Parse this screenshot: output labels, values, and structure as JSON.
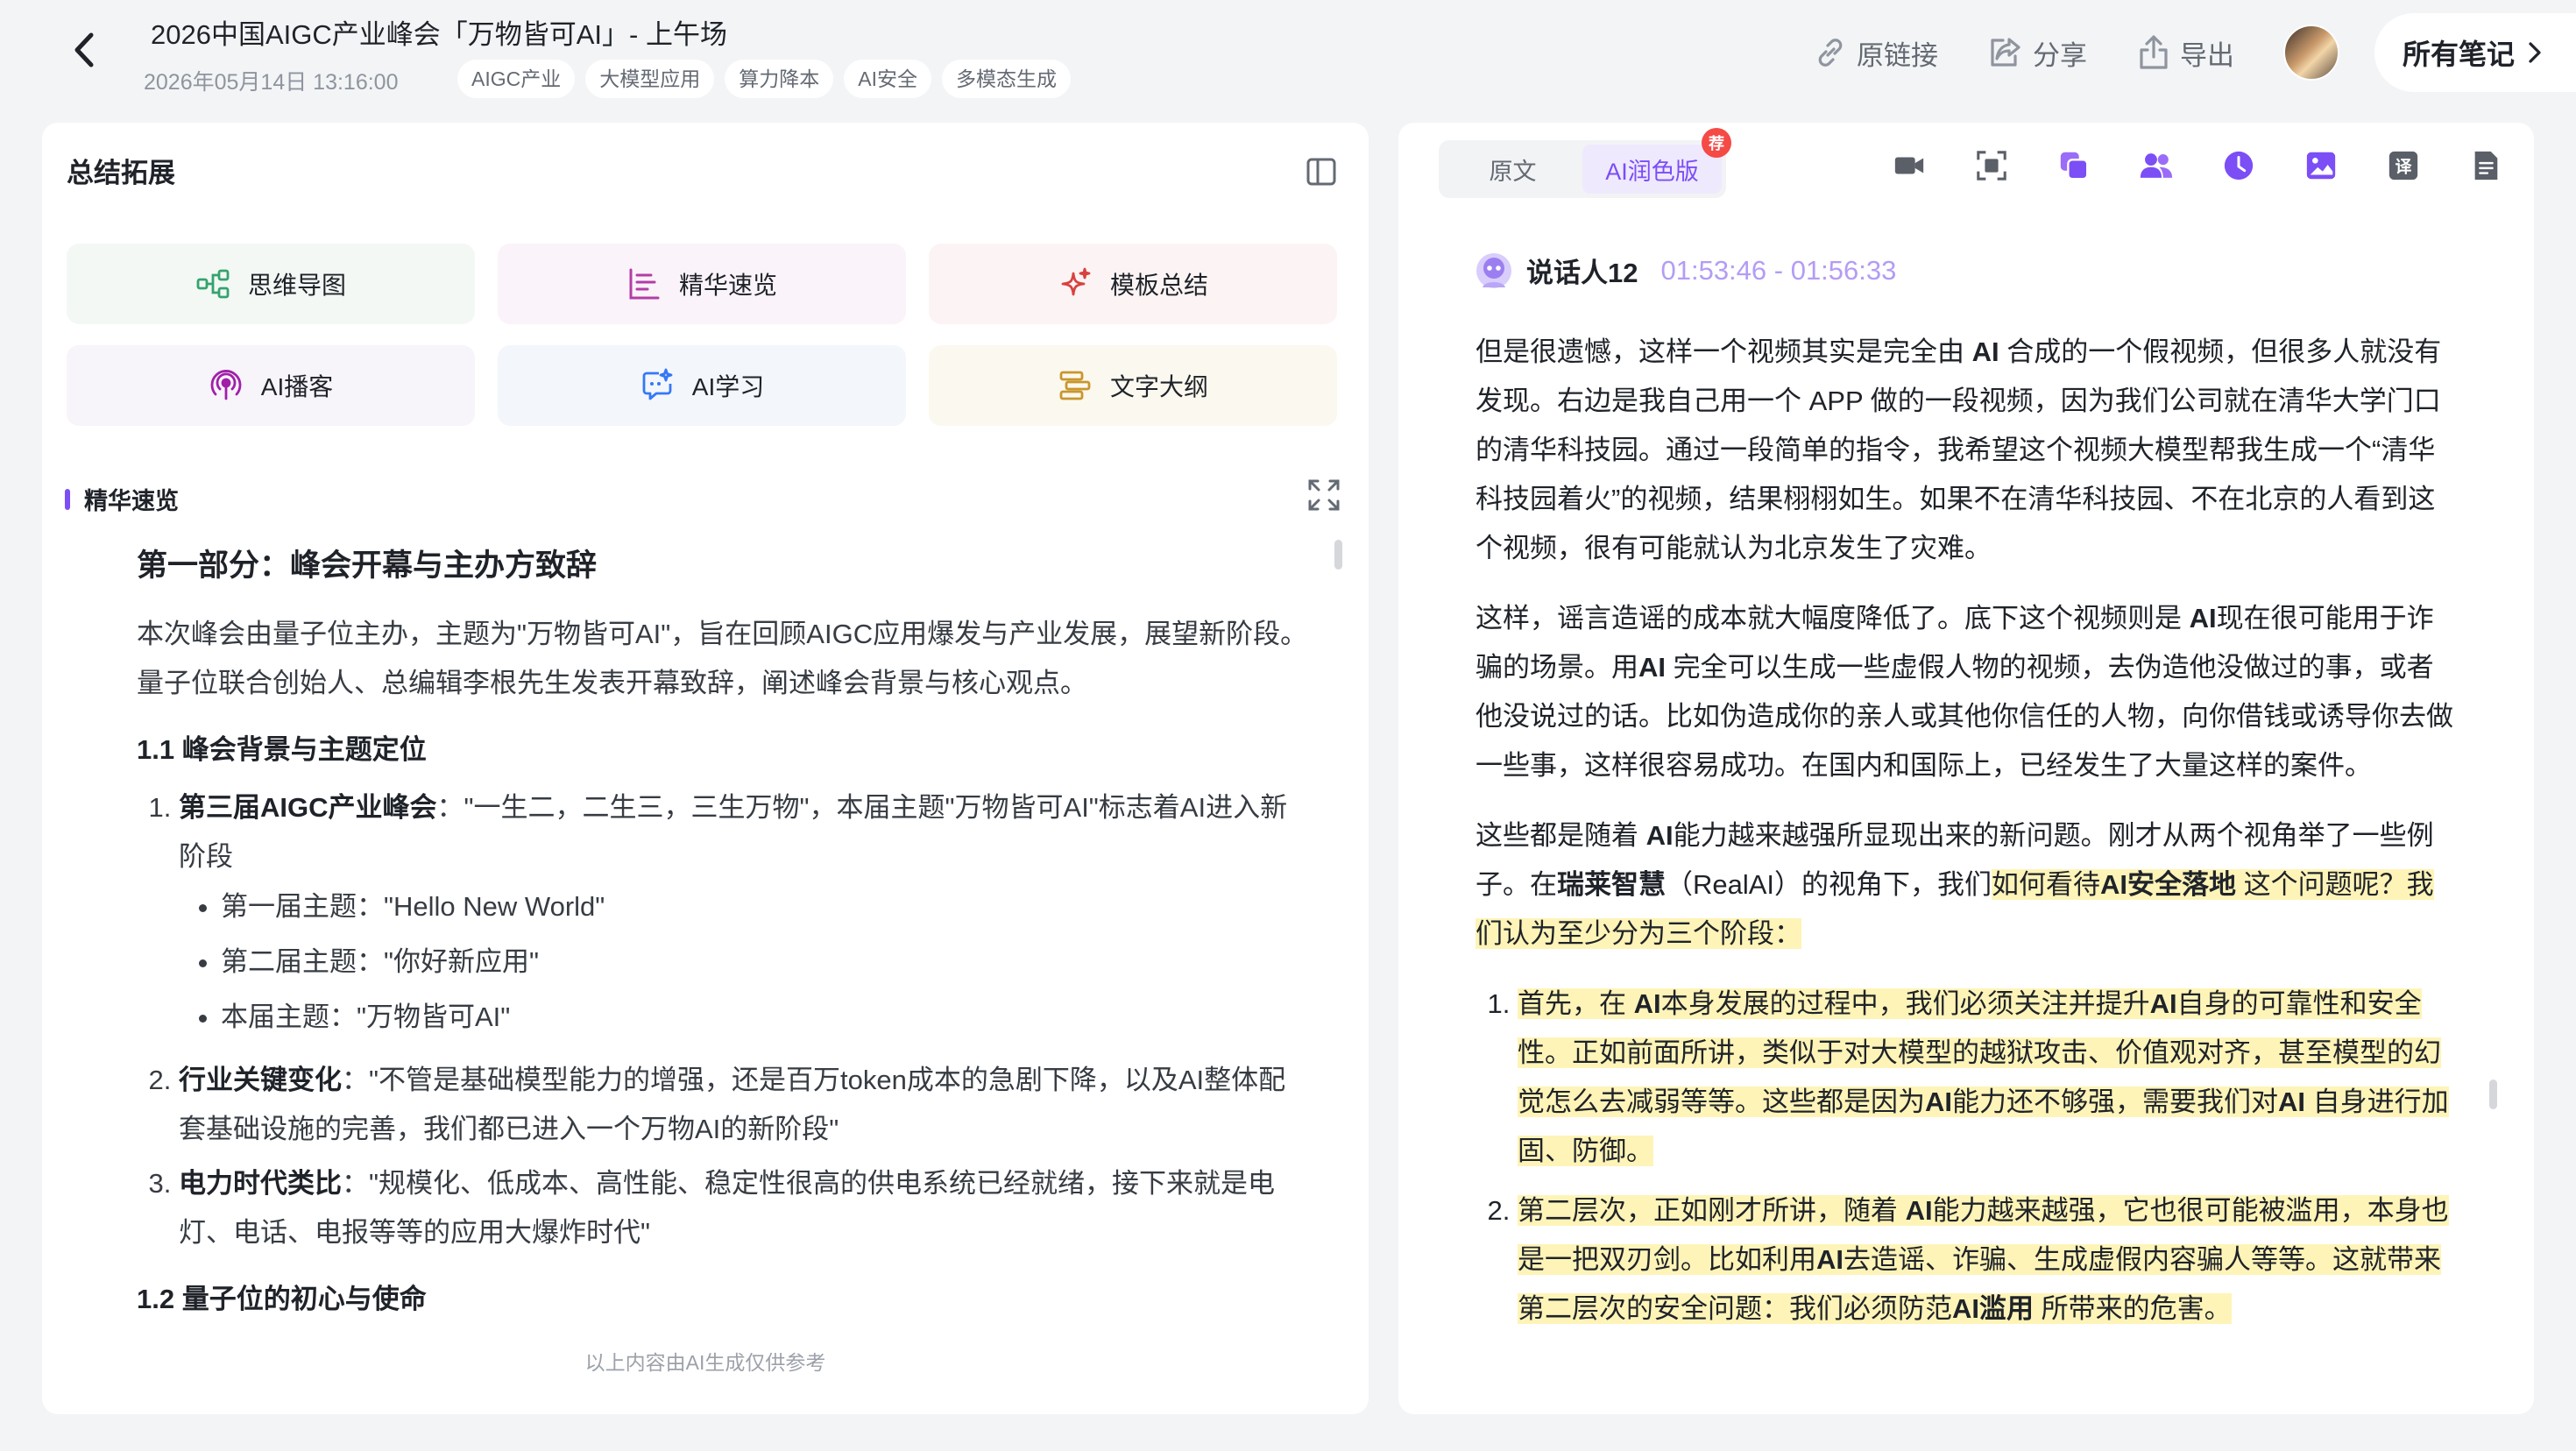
{
  "header": {
    "title": "2026中国AIGC产业峰会「万物皆可AI」- 上午场",
    "datetime": "2026年05月14日 13:16:00",
    "tags": [
      "AIGC产业",
      "大模型应用",
      "算力降本",
      "AI安全",
      "多模态生成"
    ],
    "actions": {
      "link_label": "原链接",
      "share_label": "分享",
      "export_label": "导出",
      "all_notes_label": "所有笔记"
    }
  },
  "left_panel": {
    "title": "总结拓展",
    "tools": [
      "思维导图",
      "精华速览",
      "模板总结",
      "AI播客",
      "AI学习",
      "文字大纲"
    ],
    "section_label": "精华速览",
    "summary": {
      "part_title": "第一部分：峰会开幕与主办方致辞",
      "intro": "本次峰会由量子位主办，主题为\"万物皆可AI\"，旨在回顾AIGC应用爆发与产业发展，展望新阶段。量子位联合创始人、总编辑李根先生发表开幕致辞，阐述峰会背景与核心观点。",
      "sub1_title": "1.1 峰会背景与主题定位",
      "items": [
        {
          "bold": "第三届AIGC产业峰会",
          "text": "：\"一生二，二生三，三生万物\"，本届主题\"万物皆可AI\"标志着AI进入新阶段"
        },
        {
          "bold": "行业关键变化",
          "text": "：\"不管是基础模型能力的增强，还是百万token成本的急剧下降，以及AI整体配套基础设施的完善，我们都已进入一个万物AI的新阶段\""
        },
        {
          "bold": "电力时代类比",
          "text": "：\"规模化、低成本、高性能、稳定性很高的供电系统已经就绪，接下来就是电灯、电话、电报等等的应用大爆炸时代\""
        }
      ],
      "bullets": [
        "第一届主题：\"Hello New World\"",
        "第二届主题：\"你好新应用\"",
        "本届主题：\"万物皆可AI\""
      ],
      "sub2_title": "1.2 量子位的初心与使命"
    },
    "disclaimer": "以上内容由AI生成仅供参考"
  },
  "right_panel": {
    "tabs": [
      "原文",
      "AI润色版"
    ],
    "active_tab": "AI润色版",
    "badge": "荐",
    "speaker": {
      "name": "说话人12",
      "time": "01:53:46 - 01:56:33"
    },
    "paragraphs": {
      "p1": {
        "a": "但是很遗憾，这样一个视频其实是完全由 ",
        "b": "AI",
        "c": " 合成的一个假视频，但很多人就没有发现。右边是我自己用一个 APP 做的一段视频，因为我们公司就在清华大学门口的清华科技园。通过一段简单的指令，我希望这个视频大模型帮我生成一个“清华科技园着火”的视频，结果栩栩如生。如果不在清华科技园、不在北京的人看到这个视频，很有可能就认为北京发生了灾难。"
      },
      "p2": {
        "a": "这样，谣言造谣的成本就大幅度降低了。底下这个视频则是 ",
        "b": "AI",
        "c": "现在很可能用于诈骗的场景。用",
        "d": "AI",
        "e": " 完全可以生成一些虚假人物的视频，去伪造他没做过的事，或者他没说过的话。比如伪造成你的亲人或其他你信任的人物，向你借钱或诱导你去做一些事，这样很容易成功。在国内和国际上，已经发生了大量这样的案件。"
      },
      "p3": {
        "a": "这些都是随着 ",
        "b": "AI",
        "c": "能力越来越强所显现出来的新问题。刚才从两个视角举了一些例子。在",
        "d": "瑞莱智慧",
        "e": "（RealAI）的视角下，我们",
        "f": "如何看待",
        "g": "AI安全落地",
        "h": " 这个问题呢？我们认为至少分为三个阶段："
      }
    },
    "list": {
      "i1": {
        "a": "首先，在 ",
        "b": "AI",
        "c": "本身发展的过程中，我们必须关注并提升",
        "d": "AI",
        "e": "自身的可靠性和安全性。正如前面所讲，类似于对大模型的越狱攻击、价值观对齐，甚至模型的幻觉怎么去减弱等等。这些都是因为",
        "f": "AI",
        "g": "能力还不够强，需要我们对",
        "h": "AI",
        "i": " 自身进行加固、防御。"
      },
      "i2": {
        "a": "第二层次，正如刚才所讲，随着 ",
        "b": "AI",
        "c": "能力越来越强，它也很可能被滥用，本身也是一把双刃剑。比如利用",
        "d": "AI",
        "e": "去造谣、诈骗、生成虚假内容骗人等等。这就带来第二层次的安全问题：我们必须防范",
        "f": "AI滥用",
        "g": " 所带来的危害。"
      }
    }
  },
  "colors": {
    "accent": "#7b4ef6",
    "highlight": "#fff4b8",
    "time": "#b49cf5"
  },
  "icons": {
    "right_toolbar": [
      "video-icon",
      "scan-icon",
      "copy-icon",
      "speakers-icon",
      "clock-icon",
      "image-icon",
      "translate-icon",
      "document-icon"
    ]
  }
}
